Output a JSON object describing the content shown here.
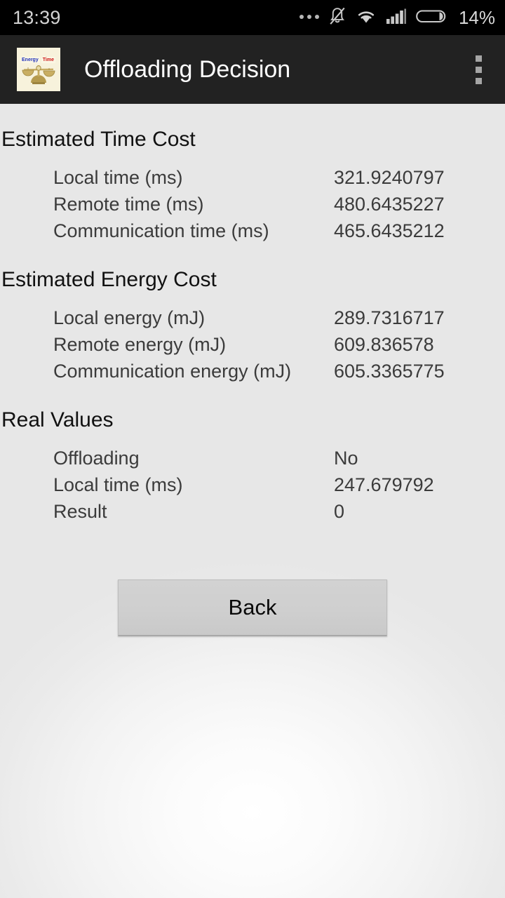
{
  "status_bar": {
    "clock": "13:39",
    "battery_percent": "14%",
    "icons": [
      "more-dots-icon",
      "bell-muted-icon",
      "wifi-icon",
      "cellular-signal-icon",
      "battery-icon"
    ]
  },
  "action_bar": {
    "title": "Offloading Decision",
    "app_icon": "balance-scale-icon",
    "icon_tag_left": "Energy",
    "icon_tag_right": "Time",
    "overflow_label": "overflow-menu-icon"
  },
  "sections": [
    {
      "header": "Estimated Time Cost",
      "rows": [
        {
          "label": "Local time (ms)",
          "value": "321.9240797"
        },
        {
          "label": "Remote time (ms)",
          "value": "480.6435227"
        },
        {
          "label": "Communication time (ms)",
          "value": "465.6435212"
        }
      ]
    },
    {
      "header": "Estimated Energy Cost",
      "rows": [
        {
          "label": "Local energy (mJ)",
          "value": "289.7316717"
        },
        {
          "label": "Remote energy (mJ)",
          "value": "609.836578"
        },
        {
          "label": "Communication energy (mJ)",
          "value": "605.3365775"
        }
      ]
    },
    {
      "header": "Real Values",
      "rows": [
        {
          "label": "Offloading",
          "value": "No"
        },
        {
          "label": "Local time (ms)",
          "value": "247.679792"
        },
        {
          "label": "Result",
          "value": "0"
        }
      ]
    }
  ],
  "back_button": {
    "label": "Back"
  },
  "colors": {
    "status_bar_bg": "#000000",
    "action_bar_bg": "#222222",
    "content_bg": "#e9e9e9",
    "header_text": "#111111",
    "row_text": "#3b3b3b",
    "button_bg": "#cfcfcf",
    "icon_energy_tag": "#2233bb",
    "icon_time_tag": "#cc1111"
  }
}
